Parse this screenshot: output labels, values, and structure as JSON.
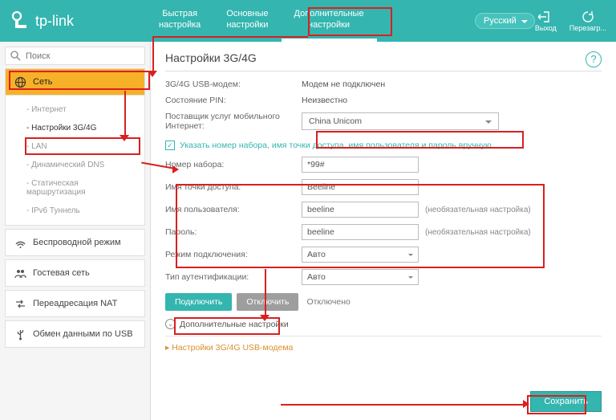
{
  "header": {
    "brand": "tp-link",
    "tabs": [
      {
        "l1": "Быстрая",
        "l2": "настройка"
      },
      {
        "l1": "Основные",
        "l2": "настройки"
      },
      {
        "l1": "Дополнительные",
        "l2": "настройки"
      }
    ],
    "language": "Русский",
    "actions": {
      "logout": "Выход",
      "reload": "Перезагр..."
    }
  },
  "search": {
    "placeholder": "Поиск"
  },
  "sidebar": {
    "network": "Сеть",
    "sub": {
      "internet": "- Интернет",
      "s3g4g": "- Настройки 3G/4G",
      "lan": "- LAN",
      "ddns": "- Динамический DNS",
      "static_route": "- Статическая маршрутизация",
      "ipv6": "- IPv6 Туннель"
    },
    "wireless": "Беспроводной режим",
    "guest": "Гостевая сеть",
    "nat": "Переадресация NAT",
    "usb": "Обмен данными по USB"
  },
  "page": {
    "title": "Настройки 3G/4G",
    "help": "?",
    "rows": {
      "modem_label": "3G/4G USB-модем:",
      "modem_value": "Модем не подключен",
      "pin_label": "Состояние PIN:",
      "pin_value": "Неизвестно",
      "isp_label": "Поставщик услуг мобильного Интернет:",
      "isp_value": "China Unicom"
    },
    "manual_check": "Указать номер набора, имя точки доступа, имя пользователя и пароль вручную",
    "dial_label": "Номер набора:",
    "dial_value": "*99#",
    "apn_label": "Имя точки доступа:",
    "apn_value": "Beeline",
    "user_label": "Имя пользователя:",
    "user_value": "beeline",
    "pass_label": "Пароль:",
    "pass_value": "beeline",
    "optional": "(необязательная настройка)",
    "connmode_label": "Режим подключения:",
    "connmode_value": "Авто",
    "auth_label": "Тип аутентификации:",
    "auth_value": "Авто",
    "connect_btn": "Подключить",
    "disconnect_btn": "Отключить",
    "conn_status": "Отключено",
    "advanced": "Дополнительные настройки",
    "usb_link": "Настройки 3G/4G USB-модема",
    "save": "Сохранить"
  }
}
